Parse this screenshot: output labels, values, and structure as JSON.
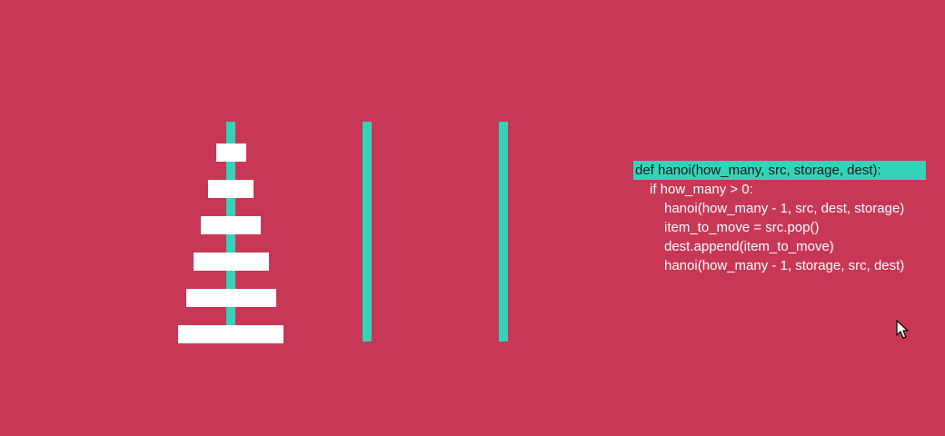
{
  "game": {
    "colors": {
      "background": "#c83755",
      "peg": "#34d3b9",
      "disc": "#ffffff",
      "highlight": "#34d3b9"
    },
    "pegs": [
      {
        "discs": [
          6,
          5,
          4,
          3,
          2,
          1
        ]
      },
      {
        "discs": []
      },
      {
        "discs": []
      }
    ],
    "disc_count": 6
  },
  "code": {
    "active_line": 0,
    "lines": [
      {
        "text": "def hanoi(how_many, src, storage, dest):",
        "indent": 0
      },
      {
        "text": "if how_many > 0:",
        "indent": 1
      },
      {
        "text": "hanoi(how_many - 1, src, dest, storage)",
        "indent": 2
      },
      {
        "text": "item_to_move = src.pop()",
        "indent": 2
      },
      {
        "text": "dest.append(item_to_move)",
        "indent": 2
      },
      {
        "text": "hanoi(how_many - 1, storage, src, dest)",
        "indent": 2
      }
    ]
  },
  "cursor": {
    "icon": "mouse-pointer-icon"
  }
}
